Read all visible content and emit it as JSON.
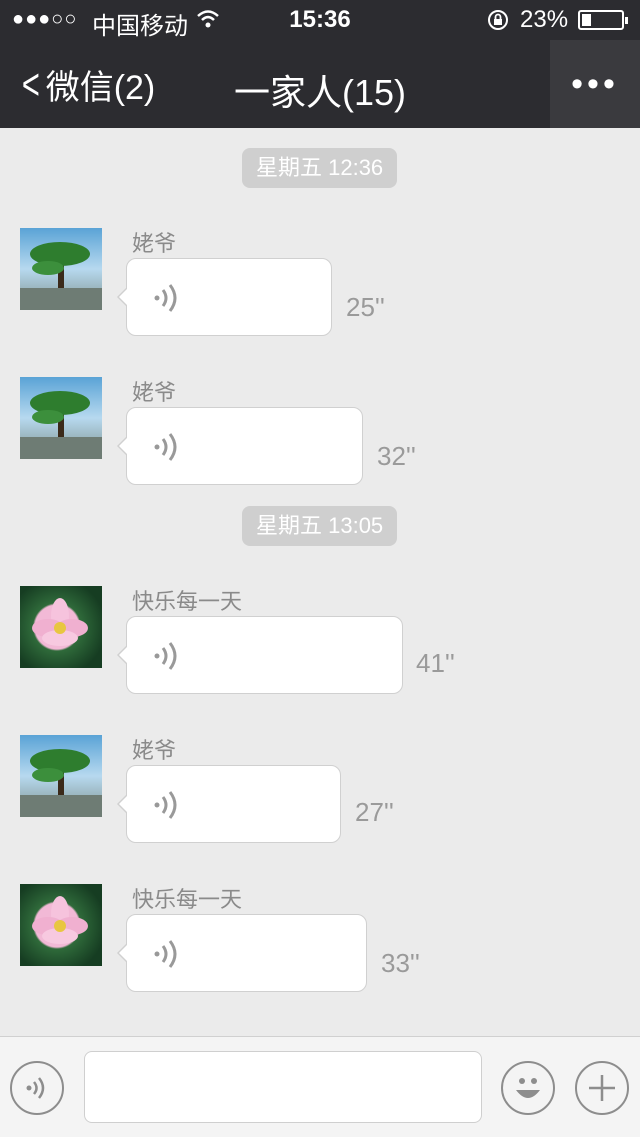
{
  "status_bar": {
    "signal": "●●●○○",
    "carrier": "中国移动",
    "time": "15:36",
    "battery_percent": "23%",
    "battery_level": 0.23
  },
  "nav": {
    "back_label": "微信(2)",
    "title": "一家人(15)",
    "more_label": "•••"
  },
  "timestamps": [
    "星期五 12:36",
    "星期五 13:05"
  ],
  "messages": [
    {
      "sender": "姥爷",
      "duration": "25''",
      "avatar": "tree-avatar"
    },
    {
      "sender": "姥爷",
      "duration": "32''",
      "avatar": "tree-avatar"
    },
    {
      "sender": "快乐每一天",
      "duration": "41''",
      "avatar": "lotus-avatar"
    },
    {
      "sender": "姥爷",
      "duration": "27''",
      "avatar": "tree-avatar"
    },
    {
      "sender": "快乐每一天",
      "duration": "33''",
      "avatar": "lotus-avatar"
    }
  ],
  "input_bar": {
    "voice_icon": "voice-icon",
    "emoji_icon": "emoji-icon",
    "add_icon": "plus-icon",
    "text_value": ""
  }
}
